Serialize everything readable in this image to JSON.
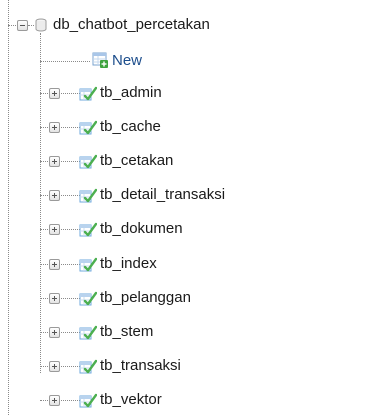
{
  "database": {
    "name": "db_chatbot_percetakan",
    "toggle_icon": "collapse-minus-icon",
    "icon": "database-icon"
  },
  "new_item": {
    "label": "New",
    "icon": "new-table-icon"
  },
  "tables": [
    {
      "name": "tb_admin",
      "icon": "table-icon",
      "toggle_icon": "expand-plus-icon"
    },
    {
      "name": "tb_cache",
      "icon": "table-icon",
      "toggle_icon": "expand-plus-icon"
    },
    {
      "name": "tb_cetakan",
      "icon": "table-icon",
      "toggle_icon": "expand-plus-icon"
    },
    {
      "name": "tb_detail_transaksi",
      "icon": "table-icon",
      "toggle_icon": "expand-plus-icon"
    },
    {
      "name": "tb_dokumen",
      "icon": "table-icon",
      "toggle_icon": "expand-plus-icon"
    },
    {
      "name": "tb_index",
      "icon": "table-icon",
      "toggle_icon": "expand-plus-icon"
    },
    {
      "name": "tb_pelanggan",
      "icon": "table-icon",
      "toggle_icon": "expand-plus-icon"
    },
    {
      "name": "tb_stem",
      "icon": "table-icon",
      "toggle_icon": "expand-plus-icon"
    },
    {
      "name": "tb_transaksi",
      "icon": "table-icon",
      "toggle_icon": "expand-plus-icon"
    },
    {
      "name": "tb_vektor",
      "icon": "table-icon",
      "toggle_icon": "expand-plus-icon"
    }
  ],
  "colors": {
    "text": "#1a1a1a",
    "new_text": "#1c4d8c",
    "tree_line": "#8a8a8a",
    "table_icon_green": "#4caf50",
    "table_icon_blue": "#6fa8dc"
  }
}
